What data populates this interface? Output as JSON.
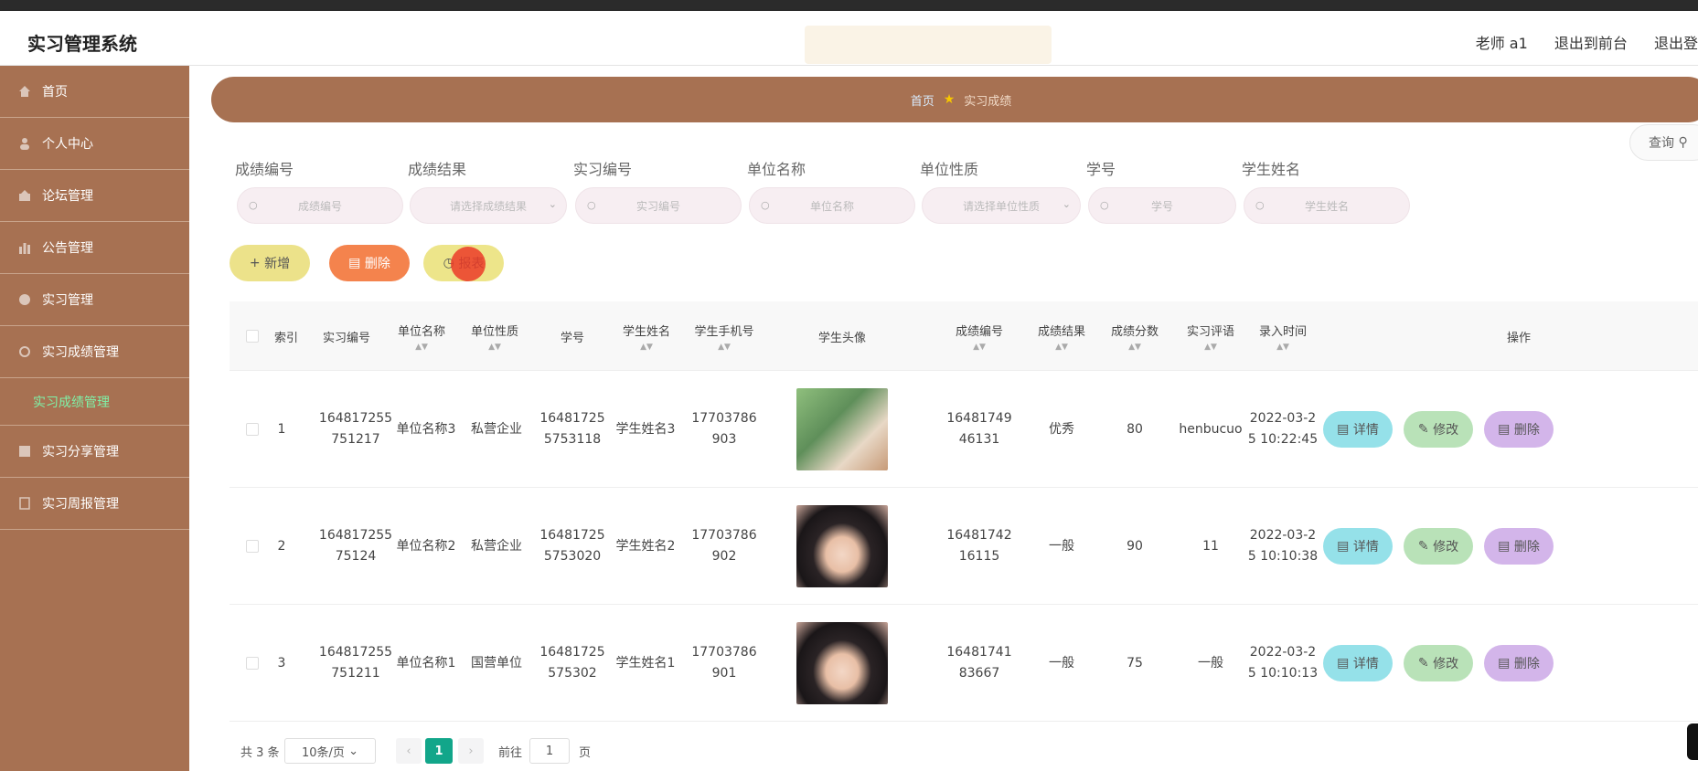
{
  "app": {
    "title": "实习管理系统"
  },
  "header": {
    "user": "老师 a1",
    "back_front": "退出到前台",
    "logout": "退出登"
  },
  "sidebar": {
    "items": [
      {
        "label": "首页"
      },
      {
        "label": "个人中心"
      },
      {
        "label": "论坛管理"
      },
      {
        "label": "公告管理"
      },
      {
        "label": "实习管理"
      },
      {
        "label": "实习成绩管理"
      }
    ],
    "sub_item": {
      "label": "实习成绩管理"
    },
    "items_after": [
      {
        "label": "实习分享管理"
      },
      {
        "label": "实习周报管理"
      }
    ]
  },
  "breadcrumb": {
    "home": "首页",
    "current": "实习成绩"
  },
  "filters": {
    "fields": [
      {
        "label": "成绩编号",
        "placeholder": "成绩编号"
      },
      {
        "label": "成绩结果",
        "placeholder": "请选择成绩结果"
      },
      {
        "label": "实习编号",
        "placeholder": "实习编号"
      },
      {
        "label": "单位名称",
        "placeholder": "单位名称"
      },
      {
        "label": "单位性质",
        "placeholder": "请选择单位性质"
      },
      {
        "label": "学号",
        "placeholder": "学号"
      },
      {
        "label": "学生姓名",
        "placeholder": "学生姓名"
      }
    ],
    "query_label": "查询"
  },
  "actions": {
    "add": "新增",
    "delete": "删除",
    "report": "报表"
  },
  "table": {
    "columns": [
      "索引",
      "实习编号",
      "单位名称",
      "单位性质",
      "学号",
      "学生姓名",
      "学生手机号",
      "学生头像",
      "成绩编号",
      "成绩结果",
      "成绩分数",
      "实习评语",
      "录入时间",
      "操作"
    ],
    "rows": [
      {
        "index": "1",
        "intern_no": [
          "164817255",
          "751217"
        ],
        "unit_name": "单位名称3",
        "unit_type": "私营企业",
        "student_no": [
          "16481725",
          "5753118"
        ],
        "student_name": "学生姓名3",
        "phone": [
          "17703786",
          "903"
        ],
        "grade_no": [
          "16481749",
          "46131"
        ],
        "result": "优秀",
        "score": "80",
        "comment": "henbucuo",
        "time": [
          "2022-03-2",
          "5 10:22:45"
        ]
      },
      {
        "index": "2",
        "intern_no": [
          "164817255",
          "75124"
        ],
        "unit_name": "单位名称2",
        "unit_type": "私营企业",
        "student_no": [
          "16481725",
          "5753020"
        ],
        "student_name": "学生姓名2",
        "phone": [
          "17703786",
          "902"
        ],
        "grade_no": [
          "16481742",
          "16115"
        ],
        "result": "一般",
        "score": "90",
        "comment": "11",
        "time": [
          "2022-03-2",
          "5 10:10:38"
        ]
      },
      {
        "index": "3",
        "intern_no": [
          "164817255",
          "751211"
        ],
        "unit_name": "单位名称1",
        "unit_type": "国营单位",
        "student_no": [
          "16481725",
          "575302"
        ],
        "student_name": "学生姓名1",
        "phone": [
          "17703786",
          "901"
        ],
        "grade_no": [
          "16481741",
          "83667"
        ],
        "result": "一般",
        "score": "75",
        "comment": "一般",
        "time": [
          "2022-03-2",
          "5 10:10:13"
        ]
      }
    ],
    "row_actions": {
      "detail": "详情",
      "edit": "修改",
      "delete": "删除"
    }
  },
  "pager": {
    "total": "共 3 条",
    "page_size": "10条/页",
    "current": "1",
    "goto_label": "前往",
    "goto_value": "1",
    "page_unit": "页"
  },
  "colors": {
    "sidebar": "#a77152",
    "accent_green": "#12a68a"
  }
}
